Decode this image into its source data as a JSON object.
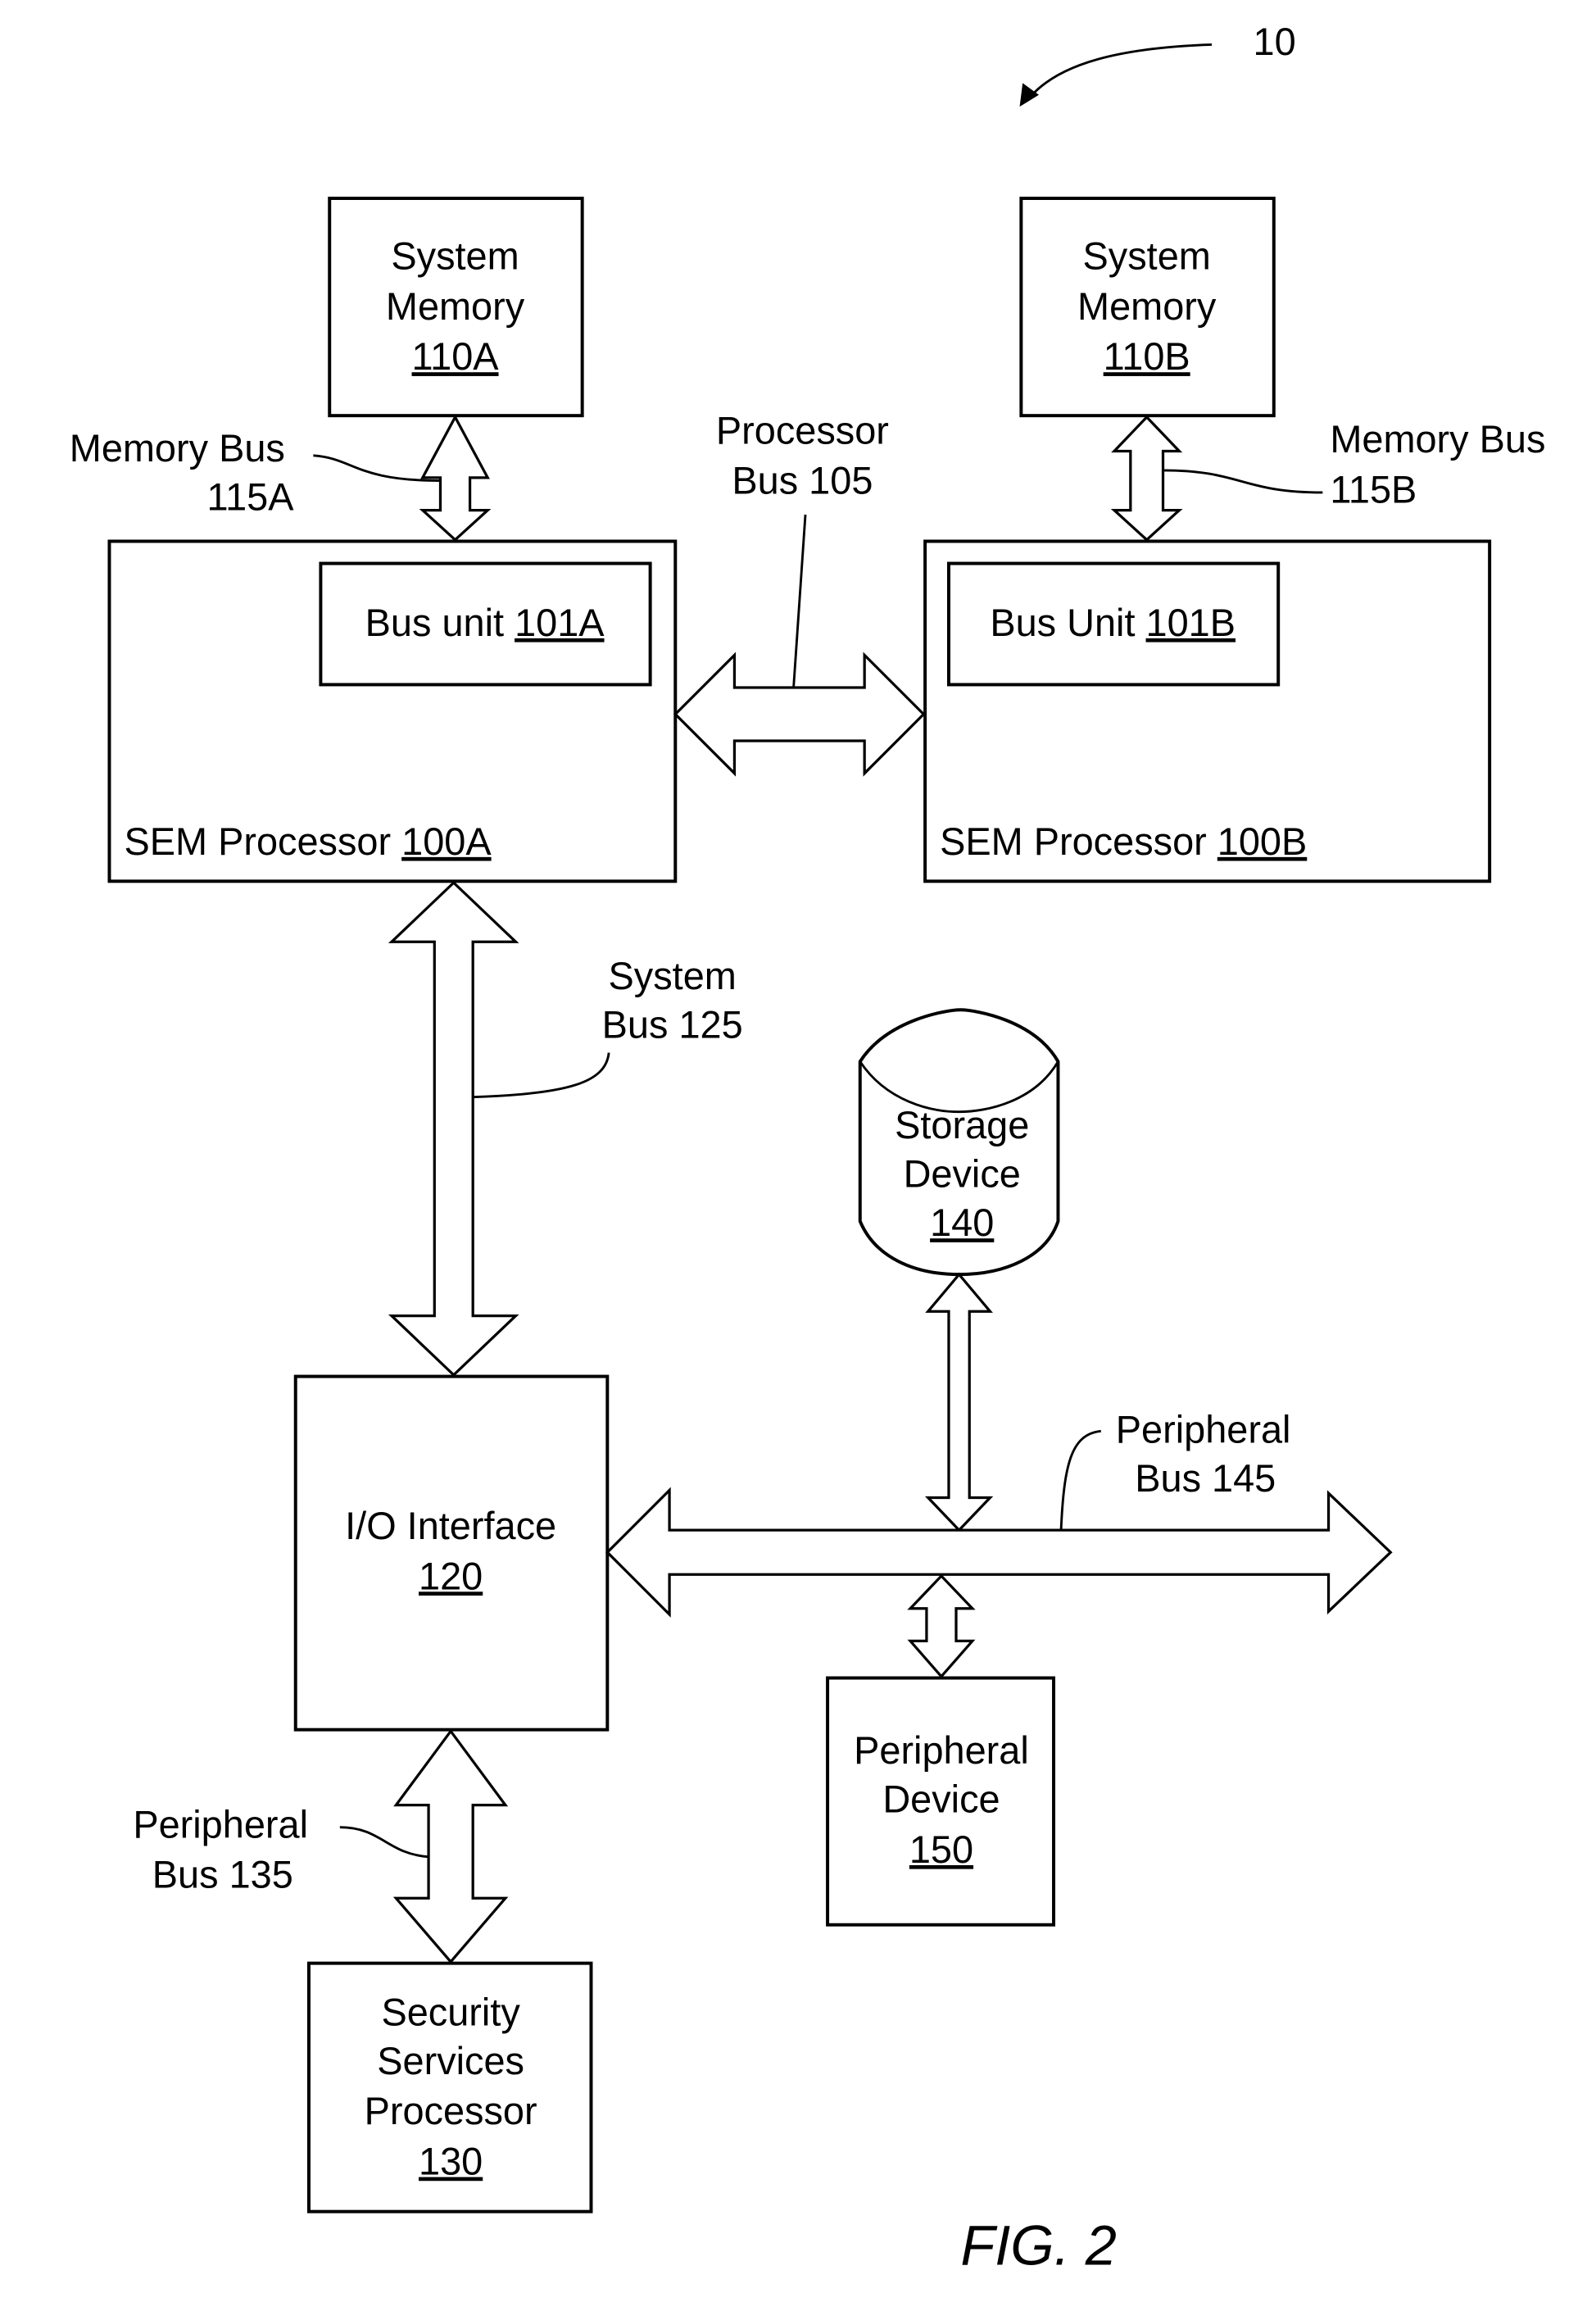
{
  "figure": {
    "label": "FIG. 2",
    "system_ref": "10"
  },
  "components": {
    "mem_a": {
      "line1": "System",
      "line2": "Memory",
      "ref": "110A"
    },
    "mem_b": {
      "line1": "System",
      "line2": "Memory",
      "ref": "110B"
    },
    "proc_a": {
      "name": "SEM Processor ",
      "ref": "100A"
    },
    "proc_b": {
      "name": "SEM Processor ",
      "ref": "100B"
    },
    "busunit_a": {
      "name": "Bus unit ",
      "ref": "101A"
    },
    "busunit_b": {
      "name": "Bus Unit ",
      "ref": "101B"
    },
    "io": {
      "line1": "I/O Interface",
      "ref": "120"
    },
    "storage": {
      "line1": "Storage",
      "line2": "Device",
      "ref": "140"
    },
    "periph_dev": {
      "line1": "Peripheral",
      "line2": "Device",
      "ref": "150"
    },
    "ssp": {
      "line1": "Security",
      "line2": "Services",
      "line3": "Processor",
      "ref": "130"
    }
  },
  "buses": {
    "mem_bus_a": {
      "line1": "Memory Bus",
      "line2": "115A"
    },
    "mem_bus_b": {
      "line1": "Memory Bus",
      "line2": "115B"
    },
    "proc_bus": {
      "line1": "Processor",
      "line2": "Bus 105"
    },
    "sys_bus": {
      "line1": "System",
      "line2": "Bus 125"
    },
    "periph_bus_145": {
      "line1": "Peripheral",
      "line2": "Bus 145"
    },
    "periph_bus_135": {
      "line1": "Peripheral",
      "line2": "Bus 135"
    }
  }
}
